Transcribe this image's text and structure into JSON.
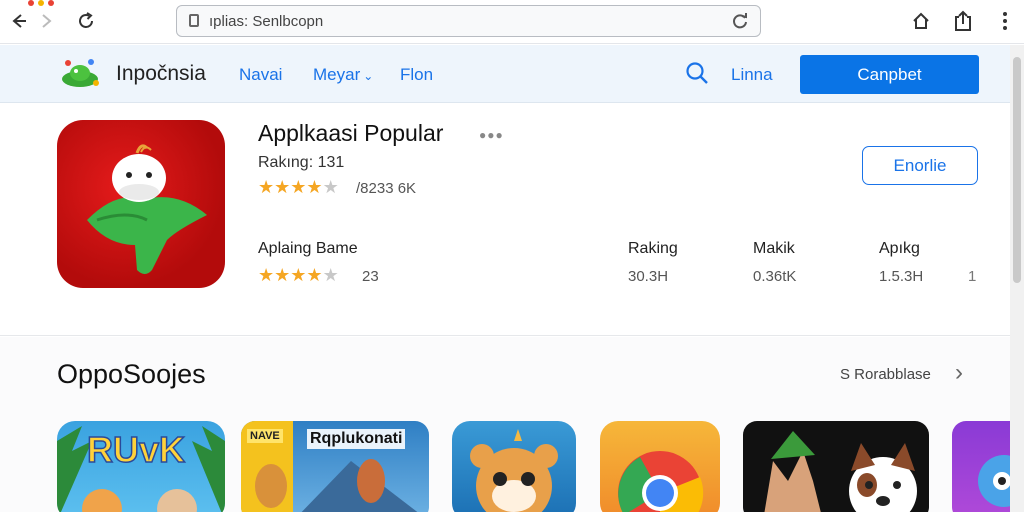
{
  "browser": {
    "url": "ıplias: Senlbcopn",
    "back_icon": "back-arrow-icon",
    "forward_icon": "forward-arrow-icon",
    "reload_icon": "reload-icon",
    "home_icon": "home-icon",
    "share_icon": "share-icon",
    "menu_icon": "kebab-menu-icon"
  },
  "header": {
    "brand": "Inpočnsia",
    "nav": [
      {
        "label": "Navai"
      },
      {
        "label": "Meyar"
      },
      {
        "label": "Flon"
      }
    ],
    "login_label": "Linna",
    "cta_label": "Canpbet",
    "accent": "#0a74e6"
  },
  "featured": {
    "title": "Applkaasi Popular",
    "ranking": "Rakıng: 131",
    "rating_stars": 4,
    "reviews": "/8233 6K",
    "install_label": "Enorlie",
    "meta": {
      "col1_label": "Aplaing Bame",
      "col1_stars": 4,
      "col1_count": "23",
      "col2_label": "Raking",
      "col2_value": "30.3H",
      "col3_label": "Makik",
      "col3_value": "0.36tK",
      "col4_label": "Apıkg",
      "col4_value": "1.5.3H",
      "extra": "1"
    }
  },
  "section": {
    "title": "OppoSoojes",
    "see_all": "S Rorabblase",
    "tiles": [
      {
        "name": "ruvk-game",
        "label": "RUvK"
      },
      {
        "name": "rqplukonati-app",
        "label": "Rqplukonati",
        "badge": "NAVE"
      },
      {
        "name": "cute-animal-app",
        "label": ""
      },
      {
        "name": "chrome-browser-app",
        "label": ""
      },
      {
        "name": "animal-friends-app",
        "label": ""
      },
      {
        "name": "purple-app",
        "label": ""
      }
    ]
  }
}
